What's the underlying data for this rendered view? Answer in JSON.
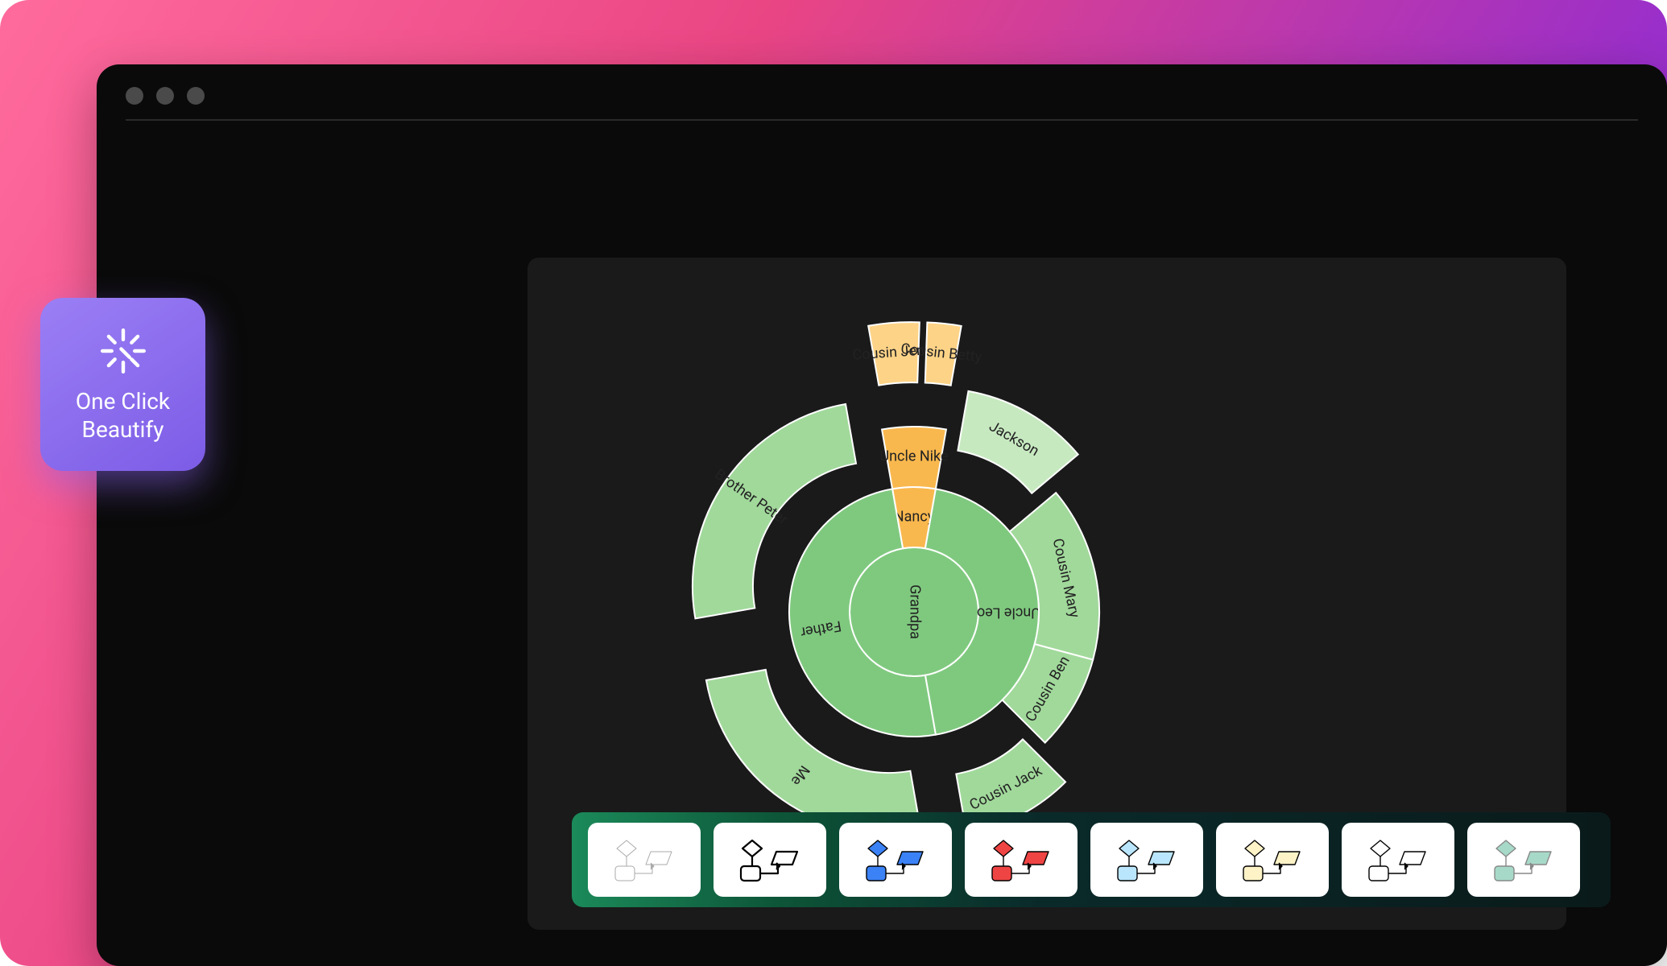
{
  "beautify": {
    "label_line1": "One Click",
    "label_line2": "Beautify"
  },
  "colors": {
    "green_dark": "#7fc97f",
    "green_mid": "#a1d99b",
    "green_light": "#c7e9c0",
    "orange_dark": "#f9b84e",
    "orange_light": "#fdd387",
    "stroke": "#ffffff"
  },
  "chart_data": {
    "type": "sunburst",
    "root": {
      "name": "Grandpa",
      "color": "green_dark",
      "children": [
        {
          "name": "Nancy",
          "color": "orange_dark",
          "angle_deg": 20,
          "children": [
            {
              "name": "Uncle Nike",
              "color": "orange_dark",
              "angle_deg": 20,
              "children": [
                {
                  "name": "Cousin Jenny",
                  "color": "orange_light",
                  "angle_deg": 12,
                  "exploded": true
                },
                {
                  "name": "Cousin Betty",
                  "color": "orange_light",
                  "angle_deg": 8,
                  "exploded": true
                }
              ]
            }
          ]
        },
        {
          "name": "Uncle Leo",
          "color": "green_dark",
          "angle_deg": 160,
          "children": [
            {
              "name": "Jackson",
              "color": "green_light",
              "angle_deg": 40,
              "exploded": true
            },
            {
              "name": "Cousin Mary",
              "color": "green_mid",
              "angle_deg": 55
            },
            {
              "name": "Cousin Ben",
              "color": "green_mid",
              "angle_deg": 30
            },
            {
              "name": "Cousin Jack",
              "color": "green_mid",
              "angle_deg": 35,
              "exploded": true
            }
          ]
        },
        {
          "name": "Father",
          "color": "green_dark",
          "angle_deg": 180,
          "children": [
            {
              "name": "Me",
              "color": "green_mid",
              "angle_deg": 90,
              "exploded": true
            },
            {
              "name": "Brother Peter",
              "color": "green_mid",
              "angle_deg": 90,
              "exploded": true
            }
          ]
        }
      ]
    }
  },
  "themes": [
    {
      "name": "outline-thin",
      "diamond": "#fff",
      "square": "#fff",
      "rect": "#fff",
      "stroke": "#aaa",
      "sw": 1
    },
    {
      "name": "outline-bold",
      "diamond": "#fff",
      "square": "#fff",
      "rect": "#fff",
      "stroke": "#000",
      "sw": 2.2
    },
    {
      "name": "blue",
      "diamond": "#3b82f6",
      "square": "#3b82f6",
      "rect": "#3b82f6",
      "stroke": "#000",
      "sw": 1.4
    },
    {
      "name": "red",
      "diamond": "#ef4444",
      "square": "#ef4444",
      "rect": "#ef4444",
      "stroke": "#000",
      "sw": 1.4
    },
    {
      "name": "sky",
      "diamond": "#bae6fd",
      "square": "#bae6fd",
      "rect": "#bae6fd",
      "stroke": "#000",
      "sw": 1.4
    },
    {
      "name": "cream",
      "diamond": "#fef3c7",
      "square": "#fef3c7",
      "rect": "#fef3c7",
      "stroke": "#000",
      "sw": 1.4
    },
    {
      "name": "white",
      "diamond": "#fff",
      "square": "#fff",
      "rect": "#fff",
      "stroke": "#000",
      "sw": 1.4
    },
    {
      "name": "mint",
      "diamond": "#a7d9c9",
      "square": "#a7d9c9",
      "rect": "#a7d9c9",
      "stroke": "#888",
      "sw": 1.4
    }
  ]
}
